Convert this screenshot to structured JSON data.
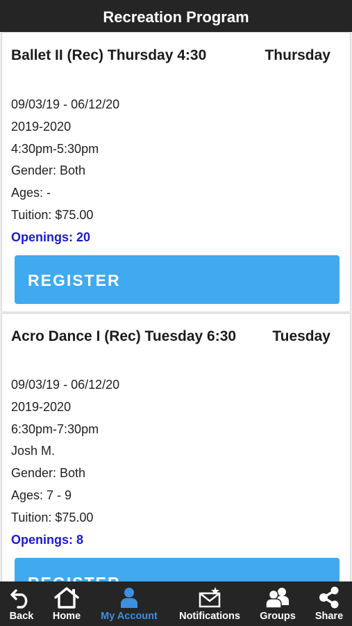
{
  "header": {
    "title": "Recreation Program"
  },
  "classes": [
    {
      "title": "Ballet II (Rec) Thursday 4:30",
      "day": "Thursday",
      "dates": "09/03/19 - 06/12/20",
      "season": "2019-2020",
      "time": "4:30pm-5:30pm",
      "gender": "Gender: Both",
      "ages": "Ages: -",
      "tuition": "Tuition: $75.00",
      "openings": "Openings: 20",
      "register_label": "REGISTER"
    },
    {
      "title": "Acro Dance I (Rec) Tuesday 6:30",
      "day": "Tuesday",
      "dates": "09/03/19 - 06/12/20",
      "season": "2019-2020",
      "time": "6:30pm-7:30pm",
      "instructor": "Josh M.",
      "gender": "Gender: Both",
      "ages": "Ages: 7 - 9",
      "tuition": "Tuition: $75.00",
      "openings": "Openings: 8",
      "register_label": "REGISTER"
    }
  ],
  "tabbar": {
    "active_color": "#3d8fe0",
    "items": [
      {
        "label": "Back",
        "icon": "back-arrow-icon"
      },
      {
        "label": "Home",
        "icon": "home-icon"
      },
      {
        "label": "My Account",
        "icon": "user-icon"
      },
      {
        "label": "Notifications",
        "icon": "envelope-star-icon"
      },
      {
        "label": "Groups",
        "icon": "group-icon"
      },
      {
        "label": "Share",
        "icon": "share-icon"
      }
    ]
  }
}
